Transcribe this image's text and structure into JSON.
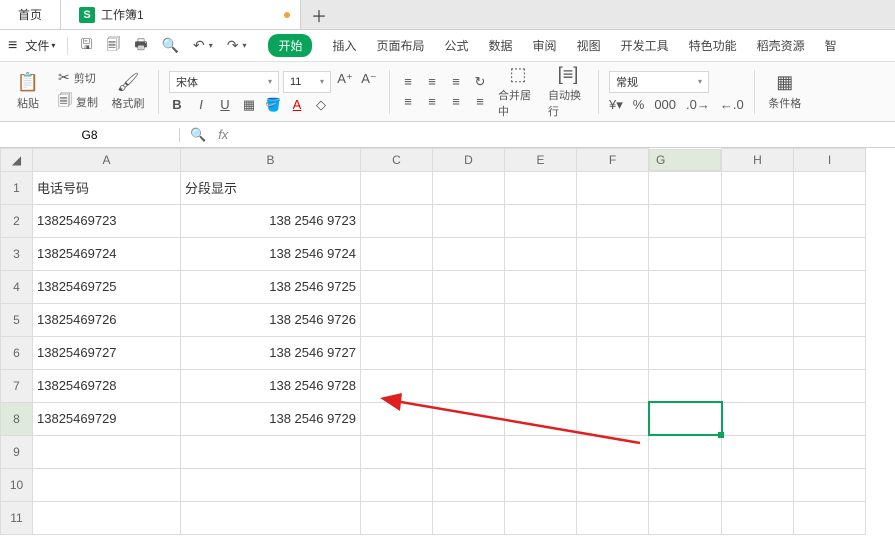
{
  "tabs": {
    "home": "首页",
    "sheet": "工作簿1"
  },
  "menu": {
    "file": "文件"
  },
  "ribbon": {
    "start": "开始",
    "insert": "插入",
    "layout": "页面布局",
    "formula": "公式",
    "data": "数据",
    "review": "审阅",
    "view": "视图",
    "dev": "开发工具",
    "special": "特色功能",
    "dao": "稻壳资源",
    "smart": "智"
  },
  "tb": {
    "paste": "粘贴",
    "cut": "剪切",
    "copy": "复制",
    "format_painter": "格式刷",
    "font_name": "宋体",
    "font_size": "11",
    "merge": "合并居中",
    "wrap": "自动换行",
    "number_format": "常规",
    "cond_fmt": "条件格"
  },
  "fx": {
    "cell_ref": "G8",
    "fx_symbol": "fx"
  },
  "chart_data": {
    "type": "table",
    "columns": [
      "A",
      "B",
      "C",
      "D",
      "E",
      "F",
      "G",
      "H",
      "I"
    ],
    "col_a_header": "电话号码",
    "col_b_header": "分段显示",
    "rows": [
      {
        "a": "13825469723",
        "b": "138 2546 9723"
      },
      {
        "a": "13825469724",
        "b": "138 2546 9724"
      },
      {
        "a": "13825469725",
        "b": "138 2546 9725"
      },
      {
        "a": "13825469726",
        "b": "138 2546 9726"
      },
      {
        "a": "13825469727",
        "b": "138 2546 9727"
      },
      {
        "a": "13825469728",
        "b": "138 2546 9728"
      },
      {
        "a": "13825469729",
        "b": "138 2546 9729"
      }
    ],
    "selected_cell": "G8"
  }
}
